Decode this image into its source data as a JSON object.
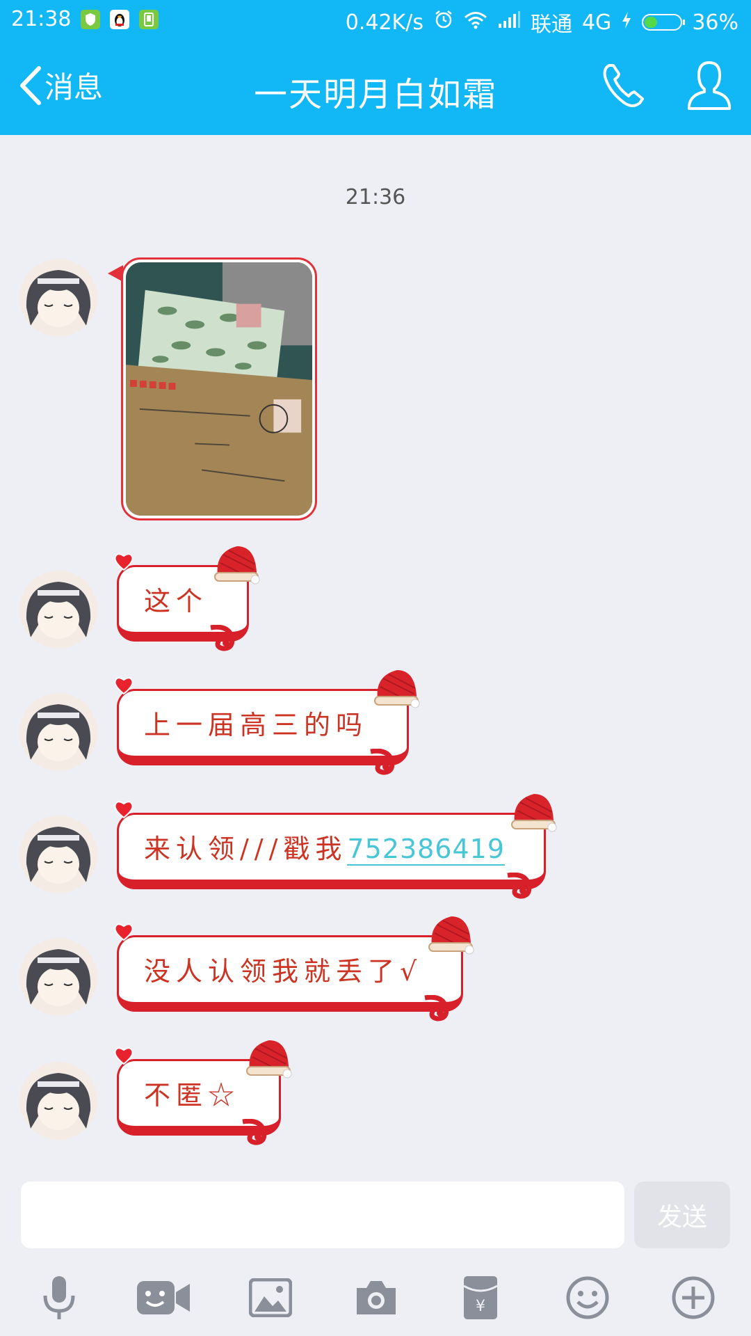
{
  "status_bar": {
    "time": "21:38",
    "network_speed": "0.42K/s",
    "carrier": "联通",
    "network_type": "4G",
    "battery_percent": "36%",
    "battery_level": 0.36
  },
  "nav": {
    "back_label": "消息",
    "title": "一天明月白如霜"
  },
  "chat": {
    "timestamp": "21:36",
    "messages": [
      {
        "type": "image"
      },
      {
        "type": "text",
        "text": "这个"
      },
      {
        "type": "text",
        "text": "上一届高三的吗"
      },
      {
        "type": "text",
        "text": "来认领///戳我",
        "link": "752386419"
      },
      {
        "type": "text",
        "text": "没人认领我就丢了√"
      },
      {
        "type": "text",
        "text": "不匿☆"
      }
    ]
  },
  "input": {
    "placeholder": "",
    "send_label": "发送"
  },
  "colors": {
    "header": "#12b7f5",
    "bubble_red": "#d7202a",
    "text_red": "#cc3322",
    "link": "#48c6d8",
    "background": "#eeeff4"
  },
  "toolbar_icons": [
    "microphone-icon",
    "video-call-icon",
    "image-icon",
    "camera-icon",
    "red-packet-icon",
    "emoji-icon",
    "plus-icon"
  ]
}
